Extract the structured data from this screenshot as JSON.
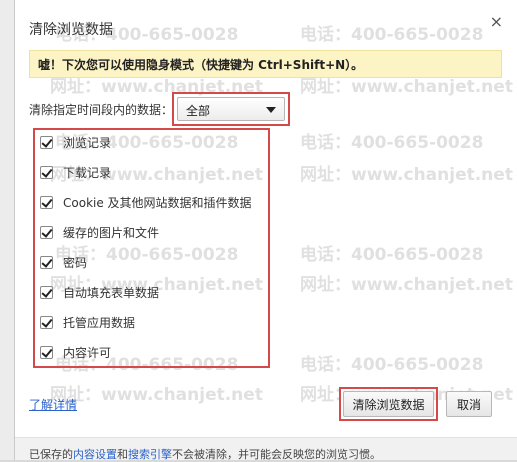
{
  "dialog": {
    "title": "清除浏览数据",
    "close_glyph": "×",
    "notice": "嘘！下次您可以使用隐身模式（快捷键为 Ctrl+Shift+N）。",
    "range_label": "清除指定时间段内的数据：",
    "range_value": "全部",
    "items": [
      {
        "label": "浏览记录",
        "checked": true
      },
      {
        "label": "下载记录",
        "checked": true
      },
      {
        "label": "Cookie 及其他网站数据和插件数据",
        "checked": true
      },
      {
        "label": "缓存的图片和文件",
        "checked": true
      },
      {
        "label": "密码",
        "checked": true
      },
      {
        "label": "自动填充表单数据",
        "checked": true
      },
      {
        "label": "托管应用数据",
        "checked": true
      },
      {
        "label": "内容许可",
        "checked": true
      }
    ],
    "learn_more": "了解详情",
    "clear_button": "清除浏览数据",
    "cancel_button": "取消",
    "footer": {
      "prefix": "已保存的",
      "link1": "内容设置",
      "and": "和",
      "link2": "搜索引擎",
      "suffix": "不会被清除，并可能会反映您的浏览习惯。"
    }
  },
  "watermark": {
    "phone": "电话：400-665-0028",
    "site": "网址：www.chanjet.net"
  },
  "colors": {
    "highlight": "#d34a4a",
    "notice_bg": "#fdf4c5",
    "link": "#2a62c9"
  }
}
